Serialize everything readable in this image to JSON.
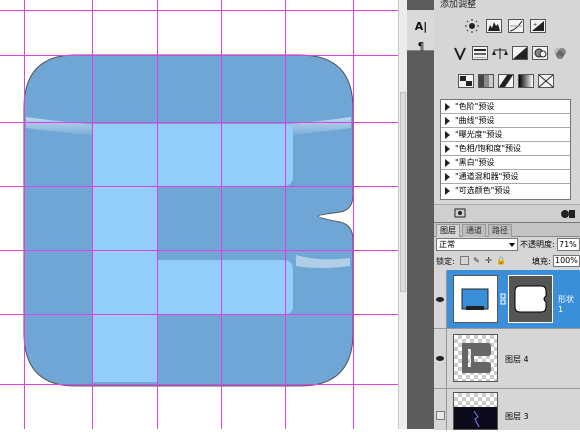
{
  "adjustments": {
    "title": "添加调整",
    "presets": [
      "\"色阶\"预设",
      "\"曲线\"预设",
      "\"曝光度\"预设",
      "\"色相/饱和度\"预设",
      "\"黑白\"预设",
      "\"通道混和器\"预设",
      "\"可选颜色\"预设"
    ]
  },
  "layers_panel": {
    "tabs": [
      "图层",
      "通道",
      "路径"
    ],
    "blend_mode": "正常",
    "opacity_label": "不透明度:",
    "opacity_value": "71%",
    "lock_label": "锁定:",
    "fill_label": "填充:",
    "fill_value": "100%",
    "layers": [
      {
        "name": "形状 1",
        "selected": true
      },
      {
        "name": "图层 4",
        "selected": false
      },
      {
        "name": "图层 3",
        "selected": false
      }
    ]
  },
  "colors": {
    "shape_outer": "#6fa6d6",
    "shape_inner": "#93cdfa",
    "guide": "#e040e0",
    "selection": "#3a8fd8"
  }
}
